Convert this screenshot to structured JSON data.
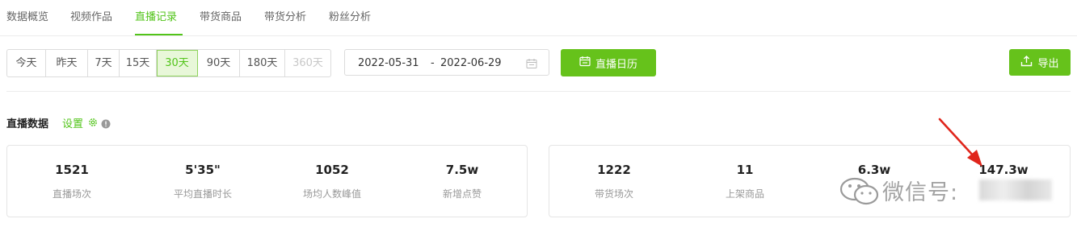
{
  "tabs": [
    {
      "label": "数据概览"
    },
    {
      "label": "视频作品"
    },
    {
      "label": "直播记录"
    },
    {
      "label": "带货商品"
    },
    {
      "label": "带货分析"
    },
    {
      "label": "粉丝分析"
    }
  ],
  "active_tab": "直播记录",
  "day_ranges": [
    {
      "label": "今天"
    },
    {
      "label": "昨天"
    },
    {
      "label": "7天"
    },
    {
      "label": "15天"
    },
    {
      "label": "30天"
    },
    {
      "label": "90天"
    },
    {
      "label": "180天"
    },
    {
      "label": "360天"
    }
  ],
  "selected_range": "30天",
  "date_range": {
    "start": "2022-05-31",
    "separator": "-",
    "end": "2022-06-29"
  },
  "calendar_button": {
    "label": "直播日历",
    "icon": "calendar-icon"
  },
  "export_button": {
    "label": "导出",
    "icon": "upload-icon"
  },
  "section": {
    "title": "直播数据",
    "settings_label": "设置"
  },
  "metrics_left": [
    {
      "value": "1521",
      "label": "直播场次"
    },
    {
      "value": "5'35\"",
      "label": "平均直播时长"
    },
    {
      "value": "1052",
      "label": "场均人数峰值"
    },
    {
      "value": "7.5w",
      "label": "新增点赞"
    }
  ],
  "metrics_right": [
    {
      "value": "1222",
      "label": "带货场次"
    },
    {
      "value": "11",
      "label": "上架商品"
    },
    {
      "value": "6.3w",
      "label": ""
    },
    {
      "value": "147.3w",
      "label": ""
    }
  ],
  "watermark": {
    "text": "微信号:"
  },
  "colors": {
    "accent": "#52c41a",
    "button": "#66c21b",
    "arrow": "#e0251b"
  }
}
